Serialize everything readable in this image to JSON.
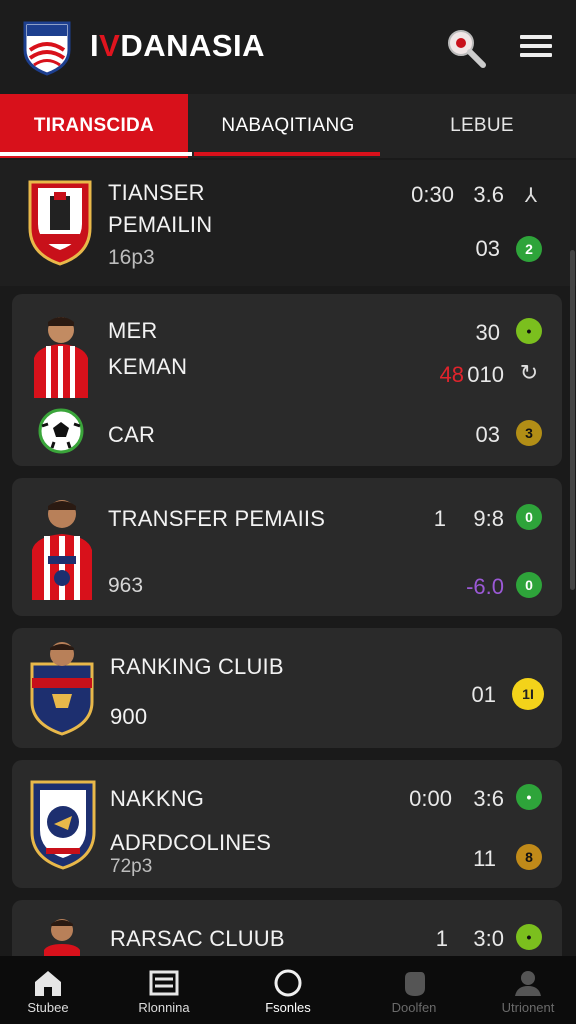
{
  "header": {
    "brand_prefix": "I",
    "brand_accent": "V",
    "brand_rest": "DANASIA",
    "logo_icon": "shield-logo-icon",
    "search_icon": "search-icon",
    "menu_icon": "hamburger-menu-icon"
  },
  "tabs": [
    {
      "label": "TIRANSCIDA",
      "active": true
    },
    {
      "label": "NABAQITIANG",
      "active": false
    },
    {
      "label": "LEBUE",
      "active": false
    }
  ],
  "items": [
    {
      "title": "TIANSER",
      "title2": "PEMAILIN",
      "sub": "16p3",
      "num1": "0:30",
      "num2": "3.6",
      "num3": "03",
      "icon1": "person-arms-icon",
      "badge": "2"
    },
    {
      "title": "MER",
      "title2": "KEMAN",
      "title3": "CAR",
      "num1": "30",
      "num_red": "48",
      "num2": "010",
      "num3": "03",
      "badge1": "•",
      "icon2": "refresh-icon",
      "badge3": "3"
    },
    {
      "title": "TRANSFER PEMAIIS",
      "sub": "963",
      "num1": "1",
      "num2": "9:8",
      "num3": "-6.0",
      "badge1": "0",
      "badge2": "0"
    },
    {
      "title": "RANKING  CLUIB",
      "sub": "900",
      "num1": "01",
      "badge": "1I"
    },
    {
      "title": "NAKKNG",
      "title2": "ADRDCOLINES",
      "sub": "72p3",
      "num1": "0:00",
      "num2": "3:6",
      "num3": "11",
      "badge1": "•",
      "badge2": "8"
    },
    {
      "title": "RARSAC CLUUB",
      "num1": "1",
      "num2": "3:0",
      "badge": "•"
    }
  ],
  "bottom_nav": [
    {
      "label": "Stubee",
      "icon": "home-icon"
    },
    {
      "label": "Rlonnina",
      "icon": "list-icon"
    },
    {
      "label": "Fsonles",
      "icon": "circle-icon"
    },
    {
      "label": "Doolfen",
      "icon": "fist-icon"
    },
    {
      "label": "Utrionent",
      "icon": "user-icon"
    }
  ],
  "colors": {
    "accent": "#d8111b",
    "background": "#1a1a1a",
    "card": "#2a2a2a",
    "badge_green": "#2ea43a",
    "badge_yellow": "#f3d31a",
    "negative_purple": "#9b59d6",
    "negative_red": "#e0242c"
  }
}
